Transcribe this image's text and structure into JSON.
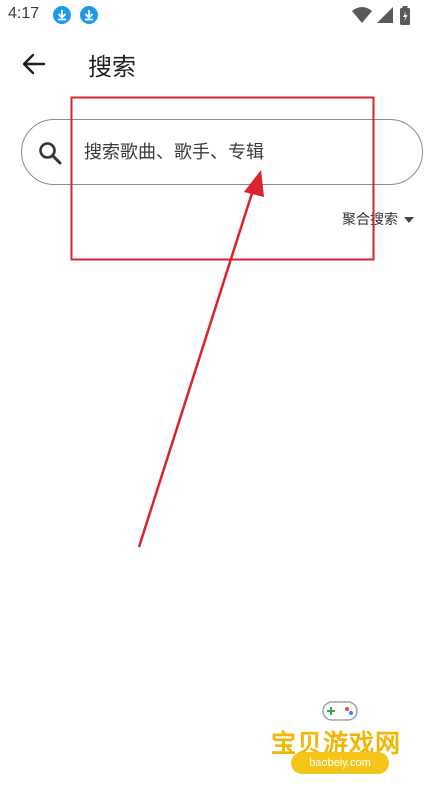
{
  "status_bar": {
    "time": "4:17",
    "icons": [
      "download-icon",
      "download-icon",
      "wifi-icon",
      "signal-icon",
      "battery-icon"
    ]
  },
  "app_bar": {
    "back_icon": "arrow-left-icon",
    "title": "搜索"
  },
  "search": {
    "placeholder": "搜索歌曲、歌手、专辑",
    "value": "",
    "icon": "search-icon"
  },
  "search_mode": {
    "label": "聚合搜索",
    "icon": "caret-down-icon"
  },
  "watermark": {
    "brand": "宝贝游戏网",
    "url": "baobeiy.com"
  },
  "colors": {
    "annotation_red": "#d9232d",
    "download_blue": "#1e9be8",
    "watermark_yellow": "#f2b705"
  }
}
